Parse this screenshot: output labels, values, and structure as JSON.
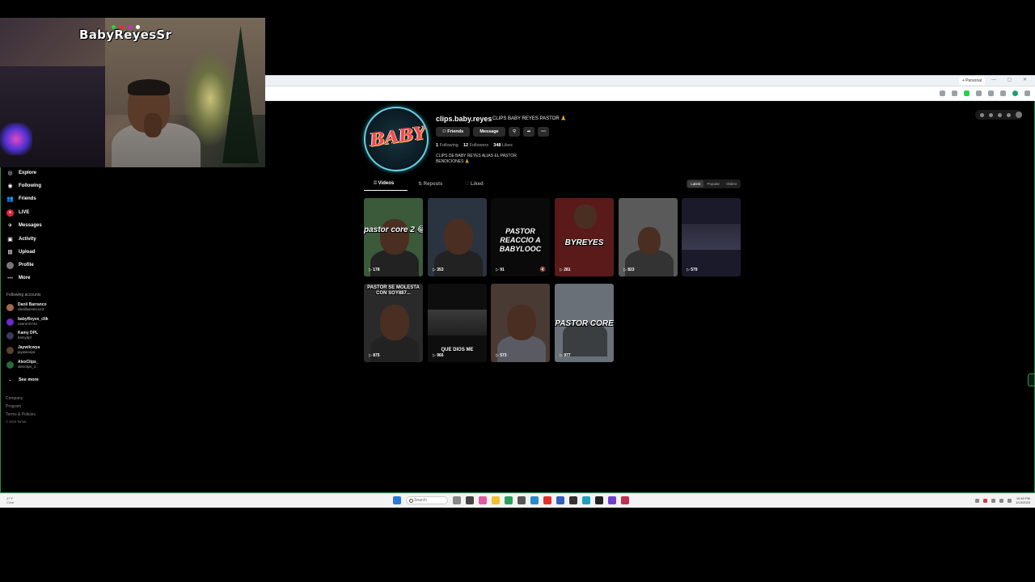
{
  "stream": {
    "name": "BabyReyesSr"
  },
  "browser": {
    "tab_label": "+ Personal"
  },
  "sidebar": {
    "items": [
      {
        "label": "Explore",
        "icon": "compass-icon"
      },
      {
        "label": "Following",
        "icon": "following-icon"
      },
      {
        "label": "Friends",
        "icon": "friends-icon"
      },
      {
        "label": "LIVE",
        "icon": "live-icon"
      },
      {
        "label": "Messages",
        "icon": "messages-icon"
      },
      {
        "label": "Activity",
        "icon": "activity-icon"
      },
      {
        "label": "Upload",
        "icon": "upload-icon"
      },
      {
        "label": "Profile",
        "icon": "profile-icon"
      },
      {
        "label": "More",
        "icon": "more-icon"
      }
    ],
    "following_title": "Following accounts",
    "accounts": [
      {
        "name": "Danii Barranco",
        "handle": "daniibarranco13"
      },
      {
        "name": "babyReyes_clik",
        "handle": "usernnn744"
      },
      {
        "name": "Kamy DPL",
        "handle": "kamydpl"
      },
      {
        "name": "Jaywiicwya",
        "handle": "jaywiicwya"
      },
      {
        "name": "AlexClips_",
        "handle": "alexclips_1"
      }
    ],
    "see_more": "See more",
    "footer": [
      "Company",
      "Program",
      "Terms & Policies",
      "© 2025 TikTok"
    ]
  },
  "profile": {
    "avatar_text": "BABY",
    "username": "clips.baby.reyes",
    "nickname": "CLIPS BABY REYES PASTOR 🙏",
    "buttons": {
      "friends": "Friends",
      "message": "Message"
    },
    "stats": {
      "following_count": "1",
      "following_label": "Following",
      "followers_count": "12",
      "followers_label": "Followers",
      "likes_count": "348",
      "likes_label": "Likes"
    },
    "bio": "CLIPS DE BABY REYES ALIAS EL PASTOR BENDICIONES 🙏"
  },
  "tabs": [
    {
      "label": "Videos",
      "icon": "grid-icon"
    },
    {
      "label": "Reposts",
      "icon": "repost-icon"
    },
    {
      "label": "Liked",
      "icon": "heart-icon"
    }
  ],
  "sorts": [
    "Latest",
    "Popular",
    "Oldest"
  ],
  "videos": [
    {
      "caption": "pastor core 2 😂",
      "views": "178",
      "bg": "#3a5a3a"
    },
    {
      "caption": "",
      "views": "353",
      "bg": "#2a3440"
    },
    {
      "caption": "PASTOR REACCIO A BABYLOOC",
      "views": "91",
      "bg": "#0a0a0a"
    },
    {
      "caption": "BYREYES",
      "views": "281",
      "bg": "#5a1a1a"
    },
    {
      "caption": "",
      "views": "823",
      "bg": "#5a5a5a"
    },
    {
      "caption": "",
      "views": "579",
      "bg": "#1a1a2a"
    },
    {
      "caption": "PASTOR SE MOLESTA CON SOY887...",
      "views": "875",
      "bg": "#2a2a2a"
    },
    {
      "caption": "QUE DIOS ME",
      "views": "966",
      "bg": "#0e0e0e"
    },
    {
      "caption": "",
      "views": "573",
      "bg": "#4a3a34"
    },
    {
      "caption": "PASTOR CORE",
      "views": "977",
      "bg": "#6a7078"
    }
  ],
  "taskbar": {
    "search_placeholder": "Search",
    "weather": [
      "47°F",
      "Clear"
    ],
    "clock": [
      "10:40 PM",
      "1/10/2025"
    ]
  }
}
